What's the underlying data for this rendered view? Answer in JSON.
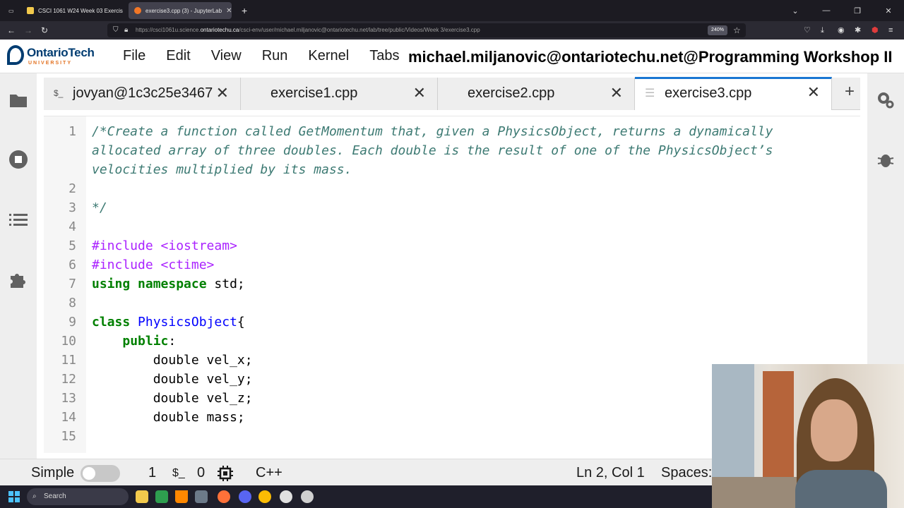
{
  "browser": {
    "tabs": [
      {
        "title": "CSCI 1061 W24 Week 03 Exercis",
        "active": false
      },
      {
        "title": "exercise3.cpp (3) - JupyterLab",
        "active": true
      }
    ],
    "url_prefix": "https://csci1061u.science.",
    "url_domain": "ontariotechu.ca",
    "url_suffix": "/csci-env/user/michael.miljanovic@ontariotechu.net/lab/tree/public/Videos/Week 3/exercise3.cpp",
    "zoom": "240%"
  },
  "logo": {
    "name": "OntarioTech",
    "sub": "UNIVERSITY"
  },
  "menu": [
    "File",
    "Edit",
    "View",
    "Run",
    "Kernel",
    "Tabs"
  ],
  "overlay_title": "michael.miljanovic@ontariotechu.net@Programming Workshop II",
  "doc_tabs": [
    {
      "label": "jovyan@1c3c25e3467",
      "icon": "terminal-icon",
      "active": false
    },
    {
      "label": "exercise1.cpp",
      "icon": "",
      "active": false
    },
    {
      "label": "exercise2.cpp",
      "icon": "",
      "active": false
    },
    {
      "label": "exercise3.cpp",
      "icon": "file-icon",
      "active": true
    }
  ],
  "editor": {
    "lines": [
      {
        "n": "1",
        "text": "/*Create a function called GetMomentum that, given a PhysicsObject, returns a dynamically",
        "style": "comment"
      },
      {
        "n": "",
        "text": "allocated array of three doubles. Each double is the result of one of the PhysicsObject’s",
        "style": "comment"
      },
      {
        "n": "",
        "text": "velocities multiplied by its mass.",
        "style": "comment"
      },
      {
        "n": "2",
        "text": "",
        "style": "comment"
      },
      {
        "n": "3",
        "text": "*/",
        "style": "comment"
      },
      {
        "n": "4",
        "text": "",
        "style": "txt"
      },
      {
        "n": "5",
        "text": "#include <iostream>",
        "style": "pre"
      },
      {
        "n": "6",
        "text": "#include <ctime>",
        "style": "pre"
      },
      {
        "n": "7",
        "text": "using namespace std;",
        "style": "using"
      },
      {
        "n": "8",
        "text": "",
        "style": "txt"
      },
      {
        "n": "9",
        "text": "class PhysicsObject{",
        "style": "class"
      },
      {
        "n": "10",
        "text": "    public:",
        "style": "kw"
      },
      {
        "n": "11",
        "text": "        double vel_x;",
        "style": "txt"
      },
      {
        "n": "12",
        "text": "        double vel_y;",
        "style": "txt"
      },
      {
        "n": "13",
        "text": "        double vel_z;",
        "style": "txt"
      },
      {
        "n": "14",
        "text": "        double mass;",
        "style": "txt"
      },
      {
        "n": "15",
        "text": "",
        "style": "txt"
      }
    ]
  },
  "status": {
    "mode": "Simple",
    "kernels": "1",
    "terminal_symbol": "$_",
    "terminals": "0",
    "language": "C++",
    "cursor": "Ln 2, Col 1",
    "spaces": "Spaces:"
  },
  "taskbar": {
    "search": "Search"
  }
}
